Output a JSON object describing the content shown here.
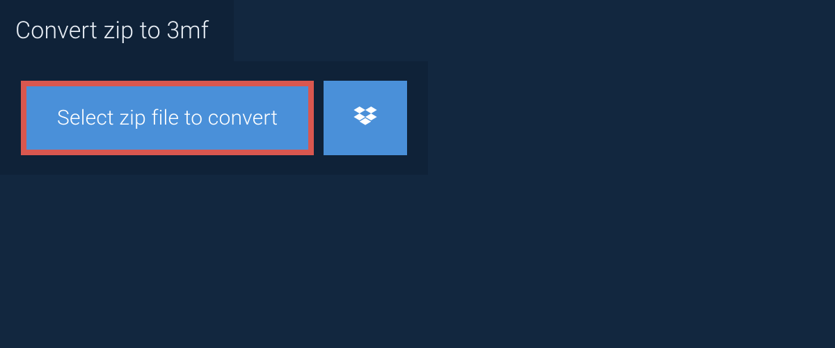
{
  "header": {
    "tab_label": "Convert zip to 3mf"
  },
  "actions": {
    "select_file_label": "Select zip file to convert",
    "dropbox_icon": "dropbox-icon"
  },
  "colors": {
    "page_bg": "#12273f",
    "panel_bg": "#0f2238",
    "button_bg": "#4a90d9",
    "button_border": "#d9574f",
    "text_light": "#ffffff"
  }
}
